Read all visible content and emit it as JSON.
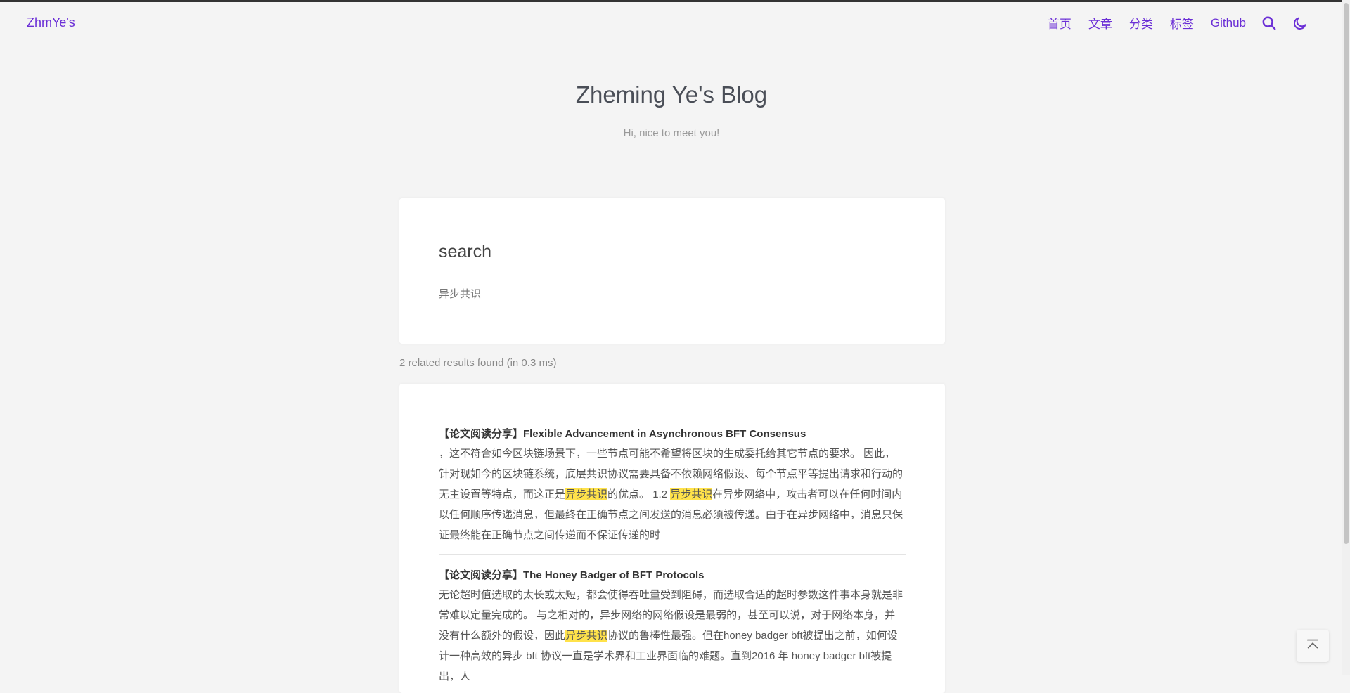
{
  "brand": "ZhmYe's",
  "nav": {
    "items": [
      "首页",
      "文章",
      "分类",
      "标签",
      "Github"
    ],
    "search_icon": "search-icon",
    "theme_icon": "moon-icon"
  },
  "hero": {
    "title": "Zheming Ye's Blog",
    "subtitle": "Hi, nice to meet you!"
  },
  "search": {
    "title": "search",
    "value": "异步共识"
  },
  "results": {
    "summary": "2 related results found (in 0.3 ms)",
    "items": [
      {
        "title": "【论文阅读分享】Flexible Advancement in Asynchronous BFT Consensus",
        "p1": "，这不符合如今区块链场景下，一些节点可能不希望将区块的生成委托给其它节点的要求。 因此，针对现如今的区块链系统，底层共识协议需要具备不依赖网络假设、每个节点平等提出请求和行动的无主设置等特点，而这正是",
        "h1": "异步共识",
        "p2": "的优点。 1.2 ",
        "h2": "异步共识",
        "p3": "在异步网络中，攻击者可以在任何时间内以任何顺序传递消息，但最终在正确节点之间发送的消息必须被传递。由于在异步网络中，消息只保证最终能在正确节点之间传递而不保证传递的时"
      },
      {
        "title": "【论文阅读分享】The Honey Badger of BFT Protocols",
        "p1": "无论超时值选取的太长或太短，都会使得吞吐量受到阻碍，而选取合适的超时参数这件事本身就是非常难以定量完成的。 与之相对的，异步网络的网络假设是最弱的，甚至可以说，对于网络本身，并没有什么额外的假设，因此",
        "h1": "异步共识",
        "p2": "协议的鲁棒性最强。但在honey badger bft被提出之前，如何设计一种高效的异步 bft 协议一直是学术界和工业界面临的难题。直到2016 年 honey badger bft被提出，人"
      }
    ]
  },
  "back_to_top_icon": "arrow-up-to-top-icon",
  "colors": {
    "accent": "#6b2fd6",
    "highlight": "#ffe24a",
    "background": "#f4f4f4"
  }
}
